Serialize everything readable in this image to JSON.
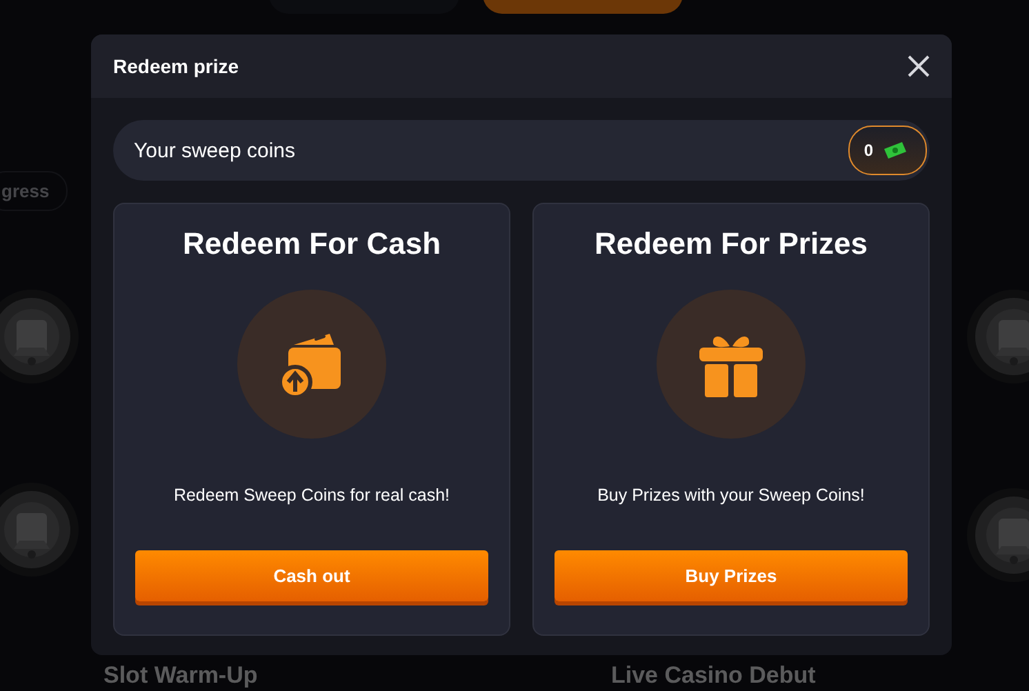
{
  "background": {
    "progress_tab": "gress",
    "games": [
      {
        "title": "Slot Warm-Up"
      },
      {
        "title": "Live Casino Debut"
      }
    ]
  },
  "dialog": {
    "title": "Redeem prize",
    "balance": {
      "label": "Your sweep coins",
      "value": "0"
    },
    "options": [
      {
        "kind": "cash",
        "title": "Redeem For Cash",
        "description": "Redeem Sweep Coins for real cash!",
        "button": "Cash out"
      },
      {
        "kind": "prize",
        "title": "Redeem For Prizes",
        "description": "Buy Prizes with your Sweep Coins!",
        "button": "Buy Prizes"
      }
    ]
  }
}
